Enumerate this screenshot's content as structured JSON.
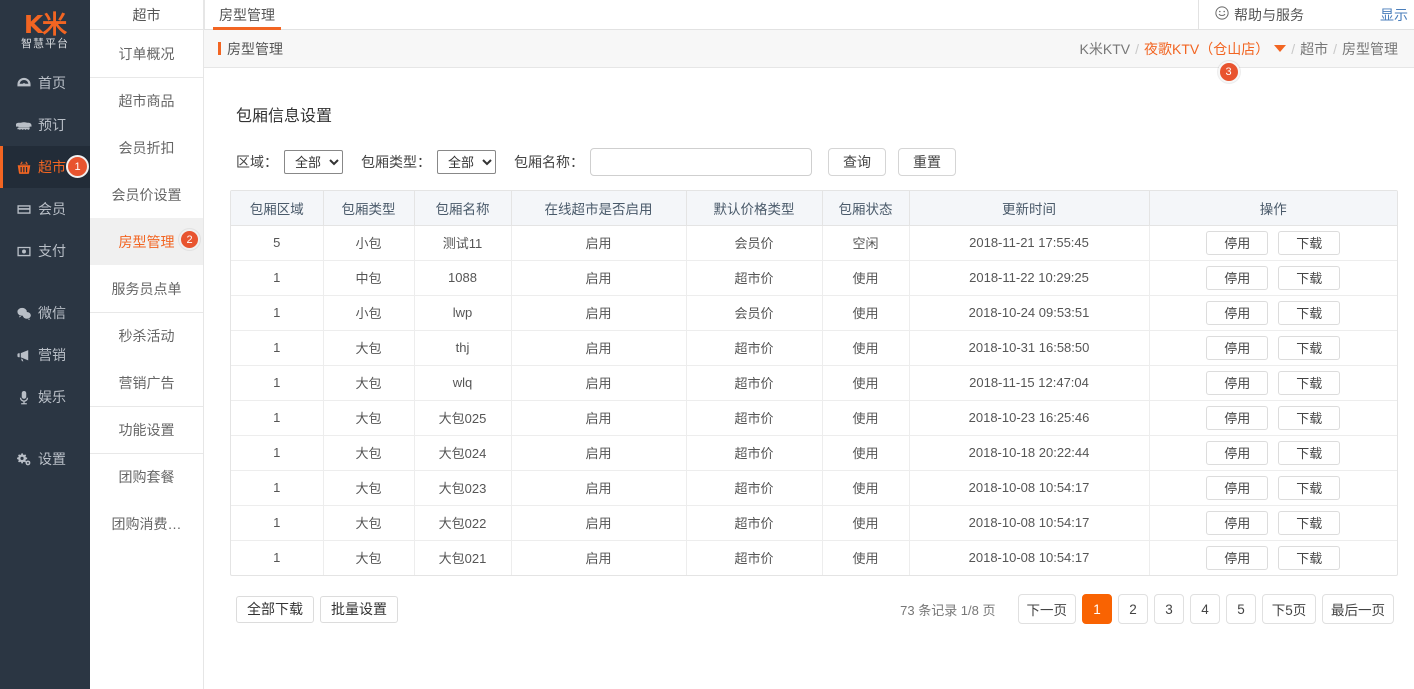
{
  "brand": {
    "logo_text": "K米",
    "logo_sub": "智慧平台",
    "accent": "#f26522",
    "badge_color": "#e8542f"
  },
  "sidebar": {
    "items": [
      {
        "label": "首页",
        "icon": "dashboard-icon",
        "badge": null,
        "active": false
      },
      {
        "label": "预订",
        "icon": "booking-icon",
        "badge": null,
        "active": false
      },
      {
        "label": "超市",
        "icon": "basket-icon",
        "badge": "1",
        "active": true
      },
      {
        "label": "会员",
        "icon": "card-icon",
        "badge": null,
        "active": false
      },
      {
        "label": "支付",
        "icon": "money-icon",
        "badge": null,
        "active": false
      },
      {
        "label": "微信",
        "icon": "wechat-icon",
        "badge": null,
        "active": false
      },
      {
        "label": "营销",
        "icon": "megaphone-icon",
        "badge": null,
        "active": false
      },
      {
        "label": "娱乐",
        "icon": "microphone-icon",
        "badge": null,
        "active": false
      },
      {
        "label": "设置",
        "icon": "gears-icon",
        "badge": null,
        "active": false
      }
    ]
  },
  "subnav": {
    "title": "超市",
    "items": [
      {
        "label": "订单概况",
        "badge": null,
        "active": false,
        "sep": false
      },
      {
        "label": "超市商品",
        "badge": null,
        "active": false,
        "sep": true
      },
      {
        "label": "会员折扣",
        "badge": null,
        "active": false,
        "sep": false
      },
      {
        "label": "会员价设置",
        "badge": null,
        "active": false,
        "sep": false
      },
      {
        "label": "房型管理",
        "badge": "2",
        "active": true,
        "sep": false
      },
      {
        "label": "服务员点单",
        "badge": null,
        "active": false,
        "sep": false
      },
      {
        "label": "秒杀活动",
        "badge": null,
        "active": false,
        "sep": true
      },
      {
        "label": "营销广告",
        "badge": null,
        "active": false,
        "sep": false
      },
      {
        "label": "功能设置",
        "badge": null,
        "active": false,
        "sep": true
      },
      {
        "label": "团购套餐",
        "badge": null,
        "active": false,
        "sep": true
      },
      {
        "label": "团购消费…",
        "badge": null,
        "active": false,
        "sep": false
      }
    ]
  },
  "topbar": {
    "tab_label": "房型管理",
    "help_label": "帮助与服务",
    "show_label": "显示"
  },
  "breadcrumb": {
    "page_label": "房型管理",
    "root": "K米KTV",
    "store": "夜歌KTV（仓山店）",
    "store_badge": "3",
    "section": "超市",
    "current": "房型管理",
    "separator": "/"
  },
  "panel": {
    "title": "包厢信息设置"
  },
  "filters": {
    "area_label": "区域：",
    "area_value": "全部",
    "area_options": [
      "全部"
    ],
    "type_label": "包厢类型：",
    "type_value": "全部",
    "type_options": [
      "全部"
    ],
    "name_label": "包厢名称：",
    "name_value": "",
    "name_placeholder": "",
    "search_button": "查询",
    "reset_button": "重置"
  },
  "table": {
    "headers": [
      "包厢区域",
      "包厢类型",
      "包厢名称",
      "在线超市是否启用",
      "默认价格类型",
      "包厢状态",
      "更新时间",
      "操作"
    ],
    "action_disable": "停用",
    "action_download": "下载",
    "rows": [
      {
        "area": "5",
        "type": "小包",
        "name": "测试11",
        "online": "启用",
        "price_type": "会员价",
        "status": "空闲",
        "updated": "2018-11-21 17:55:45"
      },
      {
        "area": "1",
        "type": "中包",
        "name": "1088",
        "online": "启用",
        "price_type": "超市价",
        "status": "使用",
        "updated": "2018-11-22 10:29:25"
      },
      {
        "area": "1",
        "type": "小包",
        "name": "lwp",
        "online": "启用",
        "price_type": "会员价",
        "status": "使用",
        "updated": "2018-10-24 09:53:51"
      },
      {
        "area": "1",
        "type": "大包",
        "name": "thj",
        "online": "启用",
        "price_type": "超市价",
        "status": "使用",
        "updated": "2018-10-31 16:58:50"
      },
      {
        "area": "1",
        "type": "大包",
        "name": "wlq",
        "online": "启用",
        "price_type": "超市价",
        "status": "使用",
        "updated": "2018-11-15 12:47:04"
      },
      {
        "area": "1",
        "type": "大包",
        "name": "大包025",
        "online": "启用",
        "price_type": "超市价",
        "status": "使用",
        "updated": "2018-10-23 16:25:46"
      },
      {
        "area": "1",
        "type": "大包",
        "name": "大包024",
        "online": "启用",
        "price_type": "超市价",
        "status": "使用",
        "updated": "2018-10-18 20:22:44"
      },
      {
        "area": "1",
        "type": "大包",
        "name": "大包023",
        "online": "启用",
        "price_type": "超市价",
        "status": "使用",
        "updated": "2018-10-08 10:54:17"
      },
      {
        "area": "1",
        "type": "大包",
        "name": "大包022",
        "online": "启用",
        "price_type": "超市价",
        "status": "使用",
        "updated": "2018-10-08 10:54:17"
      },
      {
        "area": "1",
        "type": "大包",
        "name": "大包021",
        "online": "启用",
        "price_type": "超市价",
        "status": "使用",
        "updated": "2018-10-08 10:54:17"
      }
    ]
  },
  "footer": {
    "download_all": "全部下载",
    "batch_settings": "批量设置",
    "page_info": "73 条记录 1/8 页",
    "next_page": "下一页",
    "pages": [
      "1",
      "2",
      "3",
      "4",
      "5"
    ],
    "active_page": "1",
    "next_five": "下5页",
    "last_page": "最后一页"
  }
}
